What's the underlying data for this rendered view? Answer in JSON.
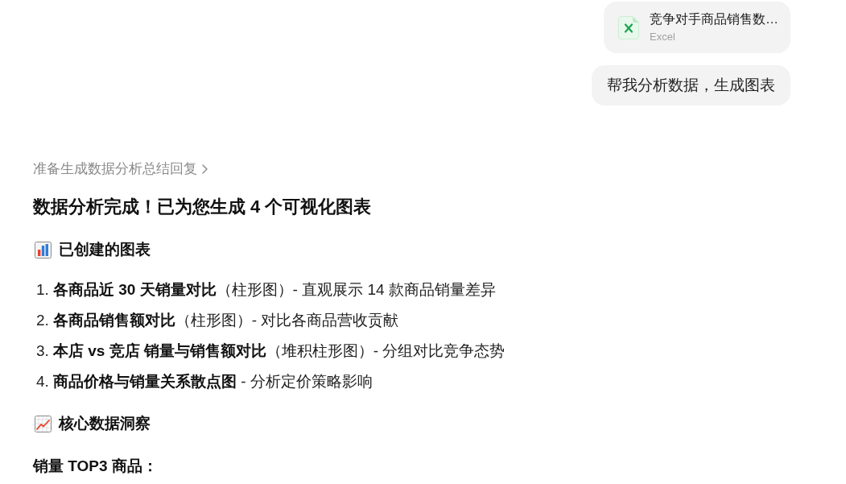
{
  "user_messages": [
    {
      "kind": "file",
      "file_name": "竞争对手商品销售数…",
      "file_type": "Excel"
    },
    {
      "kind": "text",
      "text": "帮我分析数据，生成图表"
    }
  ],
  "assistant_reply": {
    "status": "准备生成数据分析总结回复",
    "title": "数据分析完成！已为您生成 4 个可视化图表",
    "blocks": [
      {
        "kind": "chartheading",
        "text": "已创建的图表"
      },
      {
        "kind": "list",
        "items": [
          {
            "number": "1.",
            "text": "**各商品近 30 天销量对比**（柱形图）- 直观展示 14 款商品销量差异"
          },
          {
            "number": "2.",
            "text": "**各商品销售额对比**（柱形图）- 对比各商品营收贡献"
          },
          {
            "number": "3.",
            "text": "**本店 vs 竞店 销量与销售额对比**（堆积柱形图）- 分组对比竞争态势"
          },
          {
            "number": "4.",
            "text": "**商品价格与销量关系散点图** - 分析定价策略影响"
          }
        ]
      },
      {
        "kind": "trendheading",
        "text": "核心数据洞察"
      },
      {
        "kind": "label",
        "text": "销量 TOP3 商品："
      }
    ]
  }
}
